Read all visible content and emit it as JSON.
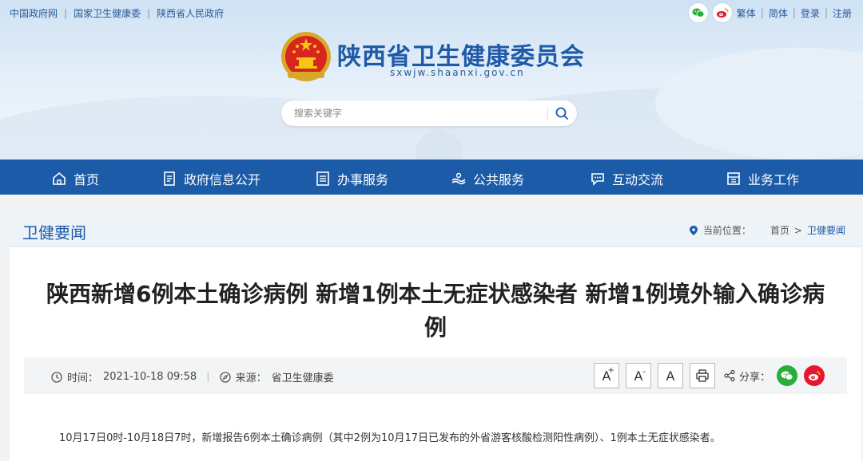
{
  "top_links": [
    "中国政府网",
    "国家卫生健康委",
    "陕西省人民政府"
  ],
  "top_right": {
    "traditional": "繁体",
    "simplified": "简体",
    "login": "登录",
    "register": "注册"
  },
  "site": {
    "title": "陕西省卫生健康委员会",
    "domain": "sxwjw.shaanxi.gov.cn"
  },
  "search": {
    "placeholder": "搜索关键字"
  },
  "nav": [
    {
      "label": "首页",
      "icon": "home-icon"
    },
    {
      "label": "政府信息公开",
      "icon": "document-icon"
    },
    {
      "label": "办事服务",
      "icon": "list-icon"
    },
    {
      "label": "公共服务",
      "icon": "hands-icon"
    },
    {
      "label": "互动交流",
      "icon": "chat-icon"
    },
    {
      "label": "业务工作",
      "icon": "work-icon"
    }
  ],
  "section": {
    "title": "卫健要闻",
    "breadcrumb_label": "当前位置：",
    "breadcrumb": [
      "首页",
      "卫健要闻"
    ],
    "breadcrumb_sep": ">"
  },
  "article": {
    "title": "陕西新增6例本土确诊病例 新增1例本土无症状感染者 新增1例境外输入确诊病例",
    "time_label": "时间：",
    "time": "2021-10-18 09:58",
    "source_label": "来源：",
    "source": "省卫生健康委",
    "font_btns": [
      "A",
      "A",
      "A"
    ],
    "share_label": "分享：",
    "body": "10月17日0时-10月18日7时，新增报告6例本土确诊病例（其中2例为10月17日已发布的外省游客核酸检测阳性病例）、1例本土无症状感染者。"
  },
  "colors": {
    "primary": "#1b5ba8",
    "wechat": "#2aae3b",
    "weibo": "#e6162d"
  }
}
